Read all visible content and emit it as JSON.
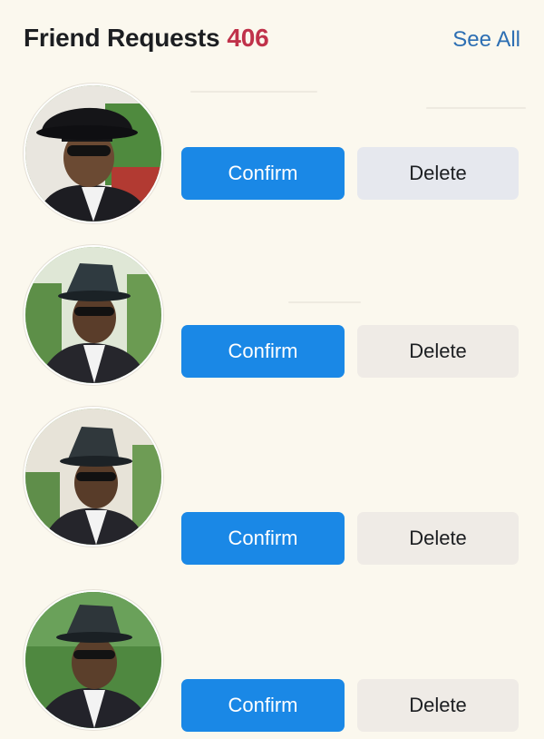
{
  "header": {
    "title": "Friend Requests",
    "count": "406",
    "see_all": "See All"
  },
  "colors": {
    "background": "#fbf8ee",
    "confirm_button": "#1a88e6",
    "delete_button": "#e6e8ee",
    "count": "#c0324a",
    "link": "#2d6fb3"
  },
  "requests": [
    {
      "confirm_label": "Confirm",
      "delete_label": "Delete"
    },
    {
      "confirm_label": "Confirm",
      "delete_label": "Delete"
    },
    {
      "confirm_label": "Confirm",
      "delete_label": "Delete"
    },
    {
      "confirm_label": "Confirm",
      "delete_label": "Delete"
    }
  ]
}
